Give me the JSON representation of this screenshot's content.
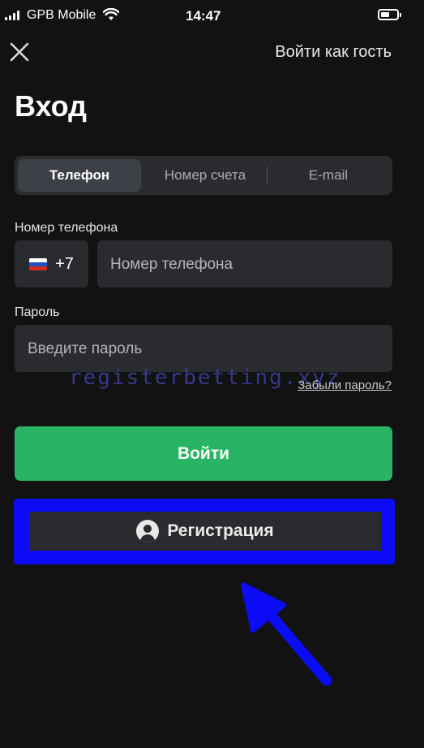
{
  "status_bar": {
    "carrier": "GPB Mobile",
    "time": "14:47"
  },
  "header": {
    "guest_label": "Войти как гость"
  },
  "title": "Вход",
  "tabs": [
    {
      "label": "Телефон",
      "active": true
    },
    {
      "label": "Номер счета",
      "active": false
    },
    {
      "label": "E-mail",
      "active": false
    }
  ],
  "phone": {
    "label": "Номер телефона",
    "country_code": "+7",
    "country_flag": "russia-flag-icon",
    "placeholder": "Номер телефона"
  },
  "password": {
    "label": "Пароль",
    "placeholder": "Введите пароль",
    "forgot_link": "Забыли пароль?"
  },
  "watermark": "registerbetting.xyz",
  "buttons": {
    "login": "Войти",
    "register": "Регистрация",
    "register_icon": "user-icon"
  },
  "colors": {
    "background": "#121212",
    "field": "#2a2b2e",
    "accent_green": "#28b462",
    "highlight_blue": "#0b0bf5"
  }
}
